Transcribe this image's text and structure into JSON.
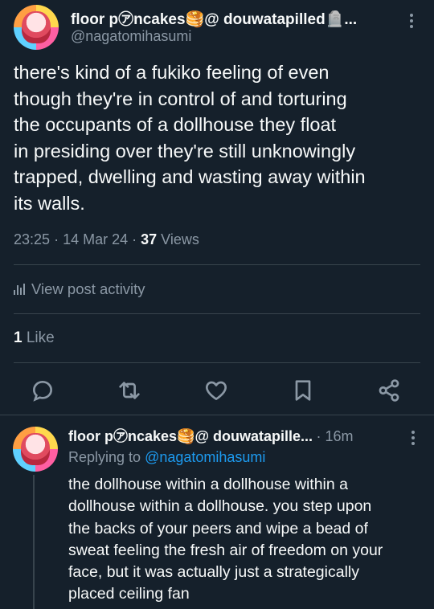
{
  "main_post": {
    "display_name": "floor p㋐ncakes🥞@ douwatapilled🪦...",
    "handle": "@nagatomihasumi",
    "text": "there's kind of a fukiko feeling of even\nthough they're in control of and torturing\nthe occupants of a dollhouse they float\nin presiding over they're still unknowingly\ntrapped, dwelling and wasting away within\nits walls.",
    "time": "23:25",
    "date": "14 Mar 24",
    "views_count": "37",
    "views_label": "Views",
    "activity_label": "View post activity",
    "likes_count": "1",
    "likes_label": "Like"
  },
  "actions": {
    "reply_icon": "reply-icon",
    "repost_icon": "repost-icon",
    "like_icon": "heart-icon",
    "bookmark_icon": "bookmark-icon",
    "share_icon": "share-icon"
  },
  "reply_post": {
    "display_name": "floor p㋐ncakes🥞@ douwatapille...",
    "time_ago": "16m",
    "replying_prefix": "Replying to",
    "replying_to": "@nagatomihasumi",
    "text": "the dollhouse within a dollhouse within a\ndollhouse within a dollhouse. you step upon\nthe backs of your peers and wipe a bead of\nsweat feeling the fresh air of freedom on your\nface, but it was actually just a strategically\nplaced ceiling fan"
  },
  "colors": {
    "background": "#15202b",
    "text_primary": "#f7f9f9",
    "text_secondary": "#8b98a5",
    "accent": "#1d9bf0",
    "divider": "#38444d"
  }
}
